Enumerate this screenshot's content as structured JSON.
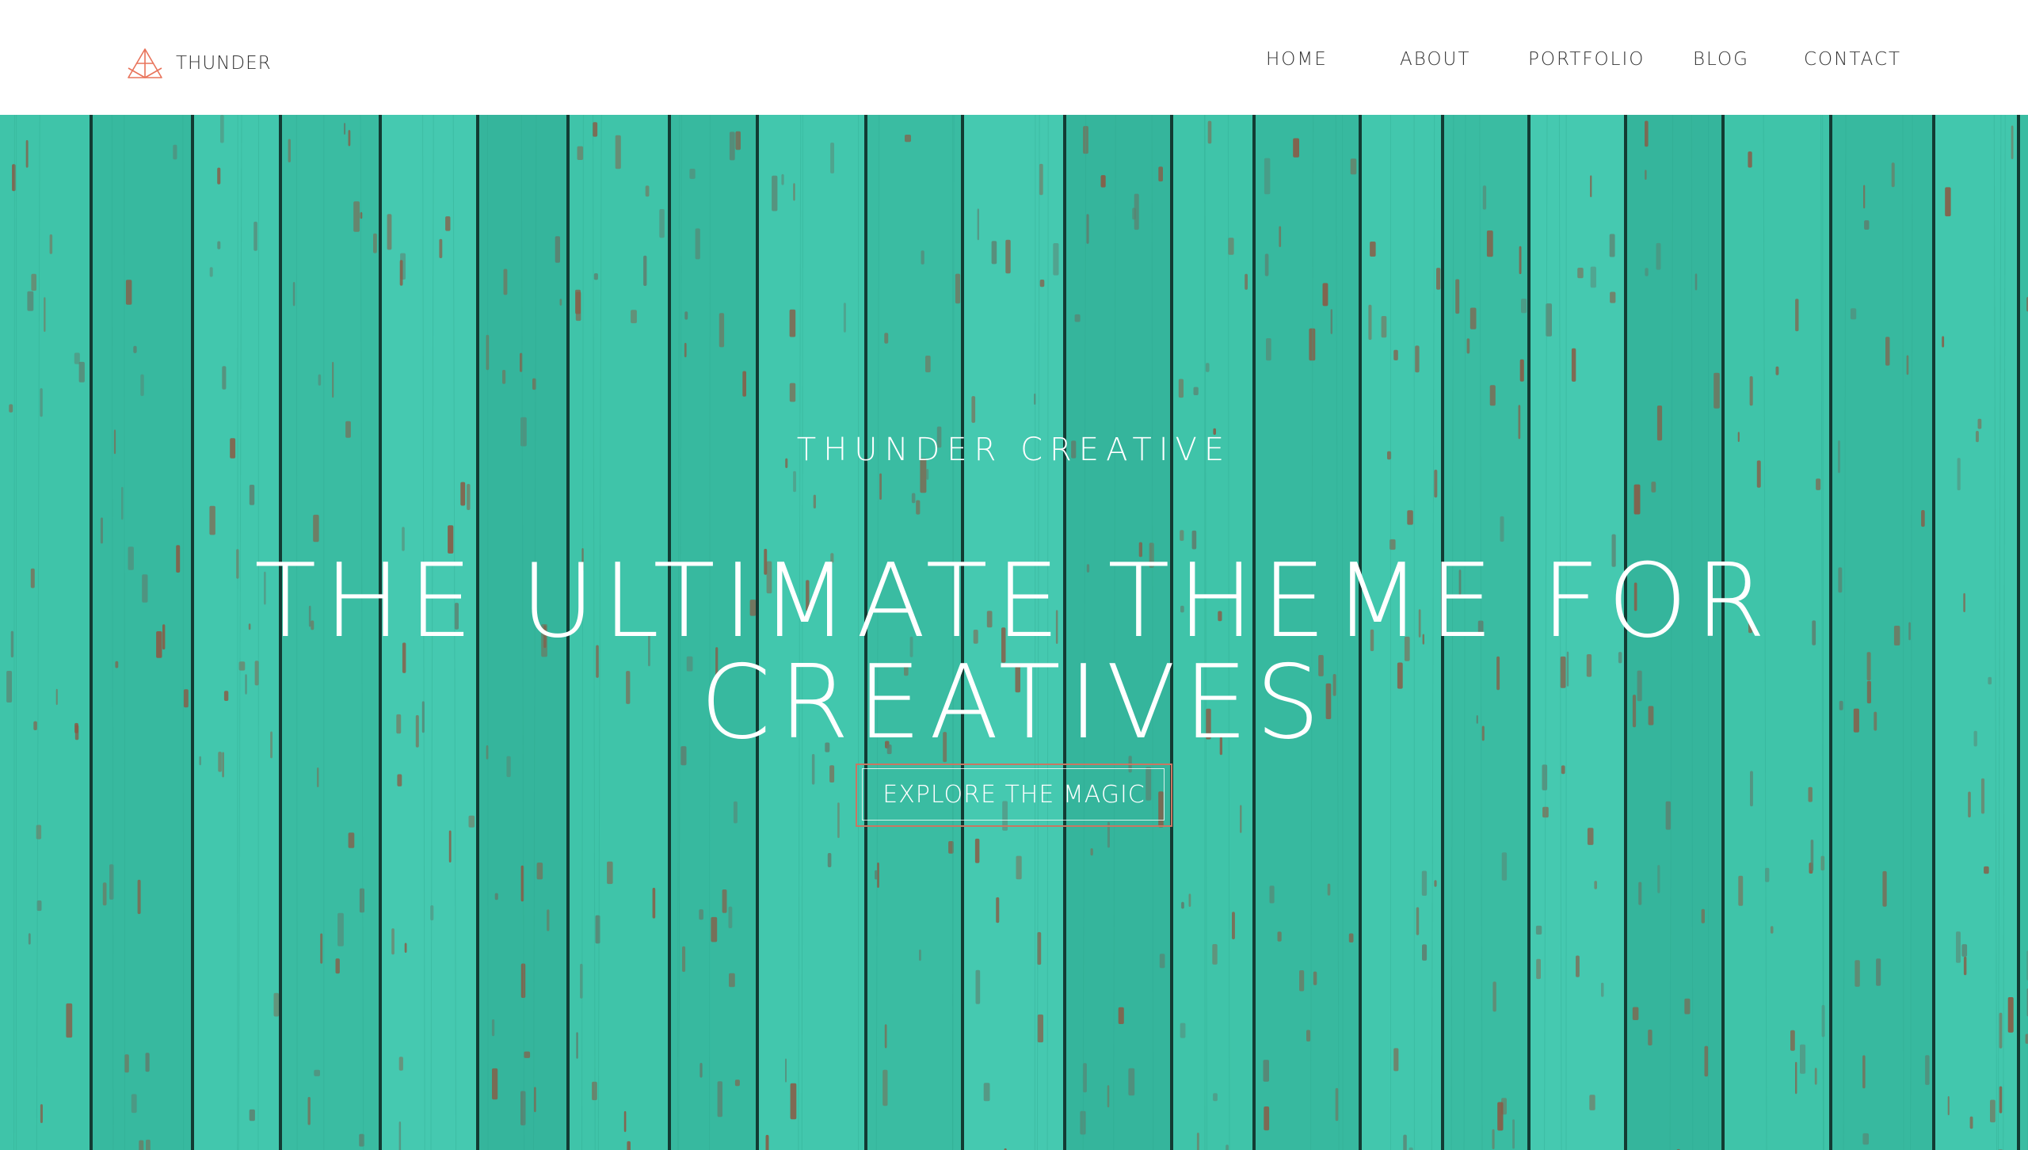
{
  "header": {
    "brand": {
      "name": "THUNDER",
      "logo_icon": "triangle-logo-icon",
      "logo_color": "#e8735a"
    },
    "nav": [
      {
        "label": "HOME"
      },
      {
        "label": "ABOUT"
      },
      {
        "label": "PORTFOLIO"
      },
      {
        "label": "BLOG"
      },
      {
        "label": "CONTACT"
      }
    ]
  },
  "hero": {
    "background": "turquoise-painted-wood-planks",
    "background_color": "#3dc0a6",
    "eyebrow": "THUNDER CREATIVE",
    "headline": "THE ULTIMATE THEME FOR CREATIVES",
    "cta_label": "EXPLORE THE MAGIC",
    "cta_border_color": "#c97763"
  }
}
